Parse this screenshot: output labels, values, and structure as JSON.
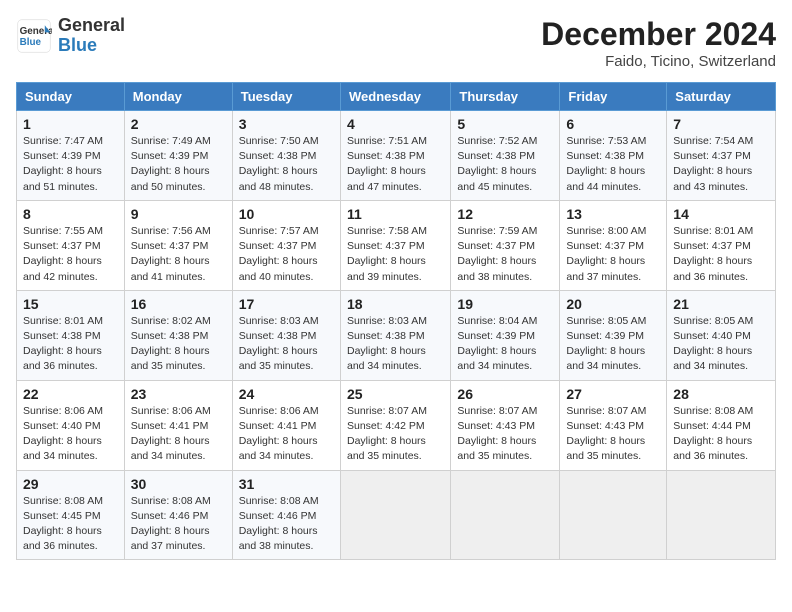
{
  "header": {
    "logo_line1": "General",
    "logo_line2": "Blue",
    "month": "December 2024",
    "location": "Faido, Ticino, Switzerland"
  },
  "weekdays": [
    "Sunday",
    "Monday",
    "Tuesday",
    "Wednesday",
    "Thursday",
    "Friday",
    "Saturday"
  ],
  "weeks": [
    [
      {
        "day": "1",
        "sunrise": "Sunrise: 7:47 AM",
        "sunset": "Sunset: 4:39 PM",
        "daylight": "Daylight: 8 hours and 51 minutes."
      },
      {
        "day": "2",
        "sunrise": "Sunrise: 7:49 AM",
        "sunset": "Sunset: 4:39 PM",
        "daylight": "Daylight: 8 hours and 50 minutes."
      },
      {
        "day": "3",
        "sunrise": "Sunrise: 7:50 AM",
        "sunset": "Sunset: 4:38 PM",
        "daylight": "Daylight: 8 hours and 48 minutes."
      },
      {
        "day": "4",
        "sunrise": "Sunrise: 7:51 AM",
        "sunset": "Sunset: 4:38 PM",
        "daylight": "Daylight: 8 hours and 47 minutes."
      },
      {
        "day": "5",
        "sunrise": "Sunrise: 7:52 AM",
        "sunset": "Sunset: 4:38 PM",
        "daylight": "Daylight: 8 hours and 45 minutes."
      },
      {
        "day": "6",
        "sunrise": "Sunrise: 7:53 AM",
        "sunset": "Sunset: 4:38 PM",
        "daylight": "Daylight: 8 hours and 44 minutes."
      },
      {
        "day": "7",
        "sunrise": "Sunrise: 7:54 AM",
        "sunset": "Sunset: 4:37 PM",
        "daylight": "Daylight: 8 hours and 43 minutes."
      }
    ],
    [
      {
        "day": "8",
        "sunrise": "Sunrise: 7:55 AM",
        "sunset": "Sunset: 4:37 PM",
        "daylight": "Daylight: 8 hours and 42 minutes."
      },
      {
        "day": "9",
        "sunrise": "Sunrise: 7:56 AM",
        "sunset": "Sunset: 4:37 PM",
        "daylight": "Daylight: 8 hours and 41 minutes."
      },
      {
        "day": "10",
        "sunrise": "Sunrise: 7:57 AM",
        "sunset": "Sunset: 4:37 PM",
        "daylight": "Daylight: 8 hours and 40 minutes."
      },
      {
        "day": "11",
        "sunrise": "Sunrise: 7:58 AM",
        "sunset": "Sunset: 4:37 PM",
        "daylight": "Daylight: 8 hours and 39 minutes."
      },
      {
        "day": "12",
        "sunrise": "Sunrise: 7:59 AM",
        "sunset": "Sunset: 4:37 PM",
        "daylight": "Daylight: 8 hours and 38 minutes."
      },
      {
        "day": "13",
        "sunrise": "Sunrise: 8:00 AM",
        "sunset": "Sunset: 4:37 PM",
        "daylight": "Daylight: 8 hours and 37 minutes."
      },
      {
        "day": "14",
        "sunrise": "Sunrise: 8:01 AM",
        "sunset": "Sunset: 4:37 PM",
        "daylight": "Daylight: 8 hours and 36 minutes."
      }
    ],
    [
      {
        "day": "15",
        "sunrise": "Sunrise: 8:01 AM",
        "sunset": "Sunset: 4:38 PM",
        "daylight": "Daylight: 8 hours and 36 minutes."
      },
      {
        "day": "16",
        "sunrise": "Sunrise: 8:02 AM",
        "sunset": "Sunset: 4:38 PM",
        "daylight": "Daylight: 8 hours and 35 minutes."
      },
      {
        "day": "17",
        "sunrise": "Sunrise: 8:03 AM",
        "sunset": "Sunset: 4:38 PM",
        "daylight": "Daylight: 8 hours and 35 minutes."
      },
      {
        "day": "18",
        "sunrise": "Sunrise: 8:03 AM",
        "sunset": "Sunset: 4:38 PM",
        "daylight": "Daylight: 8 hours and 34 minutes."
      },
      {
        "day": "19",
        "sunrise": "Sunrise: 8:04 AM",
        "sunset": "Sunset: 4:39 PM",
        "daylight": "Daylight: 8 hours and 34 minutes."
      },
      {
        "day": "20",
        "sunrise": "Sunrise: 8:05 AM",
        "sunset": "Sunset: 4:39 PM",
        "daylight": "Daylight: 8 hours and 34 minutes."
      },
      {
        "day": "21",
        "sunrise": "Sunrise: 8:05 AM",
        "sunset": "Sunset: 4:40 PM",
        "daylight": "Daylight: 8 hours and 34 minutes."
      }
    ],
    [
      {
        "day": "22",
        "sunrise": "Sunrise: 8:06 AM",
        "sunset": "Sunset: 4:40 PM",
        "daylight": "Daylight: 8 hours and 34 minutes."
      },
      {
        "day": "23",
        "sunrise": "Sunrise: 8:06 AM",
        "sunset": "Sunset: 4:41 PM",
        "daylight": "Daylight: 8 hours and 34 minutes."
      },
      {
        "day": "24",
        "sunrise": "Sunrise: 8:06 AM",
        "sunset": "Sunset: 4:41 PM",
        "daylight": "Daylight: 8 hours and 34 minutes."
      },
      {
        "day": "25",
        "sunrise": "Sunrise: 8:07 AM",
        "sunset": "Sunset: 4:42 PM",
        "daylight": "Daylight: 8 hours and 35 minutes."
      },
      {
        "day": "26",
        "sunrise": "Sunrise: 8:07 AM",
        "sunset": "Sunset: 4:43 PM",
        "daylight": "Daylight: 8 hours and 35 minutes."
      },
      {
        "day": "27",
        "sunrise": "Sunrise: 8:07 AM",
        "sunset": "Sunset: 4:43 PM",
        "daylight": "Daylight: 8 hours and 35 minutes."
      },
      {
        "day": "28",
        "sunrise": "Sunrise: 8:08 AM",
        "sunset": "Sunset: 4:44 PM",
        "daylight": "Daylight: 8 hours and 36 minutes."
      }
    ],
    [
      {
        "day": "29",
        "sunrise": "Sunrise: 8:08 AM",
        "sunset": "Sunset: 4:45 PM",
        "daylight": "Daylight: 8 hours and 36 minutes."
      },
      {
        "day": "30",
        "sunrise": "Sunrise: 8:08 AM",
        "sunset": "Sunset: 4:46 PM",
        "daylight": "Daylight: 8 hours and 37 minutes."
      },
      {
        "day": "31",
        "sunrise": "Sunrise: 8:08 AM",
        "sunset": "Sunset: 4:46 PM",
        "daylight": "Daylight: 8 hours and 38 minutes."
      },
      null,
      null,
      null,
      null
    ]
  ]
}
